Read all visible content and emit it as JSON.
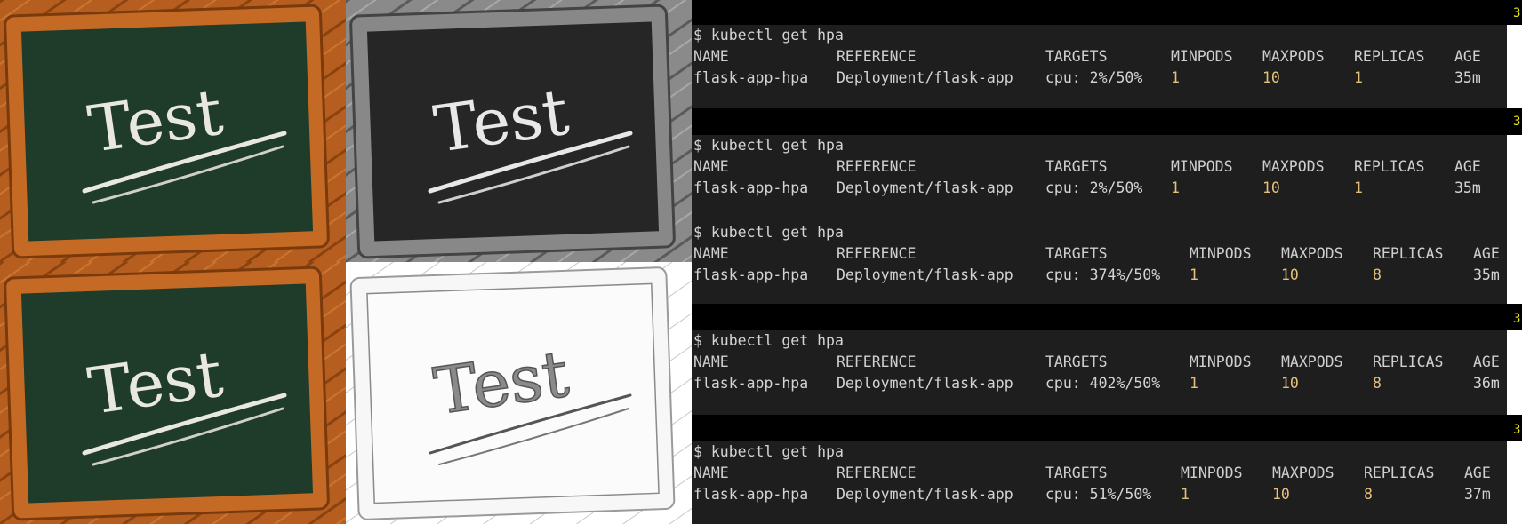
{
  "colors": {
    "wood": "#b35d1e",
    "chalkboard": "#1f3b2a",
    "chalk": "#e8e8e0",
    "terminal_bg": "#1e1e1e",
    "number_text": "#e5c07b",
    "marker_yellow": "#e5e510"
  },
  "images": [
    {
      "name": "chalkboard-test-color",
      "chalk_text": "Test"
    },
    {
      "name": "chalkboard-test-grayscale",
      "chalk_text": "Test"
    },
    {
      "name": "chalkboard-test-color-copy",
      "chalk_text": "Test"
    },
    {
      "name": "chalkboard-test-sketch",
      "chalk_text": "Test"
    }
  ],
  "terminal": {
    "prompt": "$",
    "marker": "3",
    "blocks": [
      {
        "command": "kubectl get hpa",
        "headers": [
          "NAME",
          "REFERENCE",
          "TARGETS",
          "MINPODS",
          "MAXPODS",
          "REPLICAS",
          "AGE"
        ],
        "row": [
          "flask-app-hpa",
          "Deployment/flask-app",
          "cpu: 2%/50%",
          "1",
          "10",
          "1",
          "35m"
        ]
      },
      {
        "command": "kubectl get hpa",
        "headers": [
          "NAME",
          "REFERENCE",
          "TARGETS",
          "MINPODS",
          "MAXPODS",
          "REPLICAS",
          "AGE"
        ],
        "row": [
          "flask-app-hpa",
          "Deployment/flask-app",
          "cpu: 2%/50%",
          "1",
          "10",
          "1",
          "35m"
        ]
      },
      {
        "command": "kubectl get hpa",
        "headers": [
          "NAME",
          "REFERENCE",
          "TARGETS",
          "MINPODS",
          "MAXPODS",
          "REPLICAS",
          "AGE"
        ],
        "row": [
          "flask-app-hpa",
          "Deployment/flask-app",
          "cpu: 374%/50%",
          "1",
          "10",
          "8",
          "35m"
        ]
      },
      {
        "command": "kubectl get hpa",
        "headers": [
          "NAME",
          "REFERENCE",
          "TARGETS",
          "MINPODS",
          "MAXPODS",
          "REPLICAS",
          "AGE"
        ],
        "row": [
          "flask-app-hpa",
          "Deployment/flask-app",
          "cpu: 402%/50%",
          "1",
          "10",
          "8",
          "36m"
        ]
      },
      {
        "command": "kubectl get hpa",
        "headers": [
          "NAME",
          "REFERENCE",
          "TARGETS",
          "MINPODS",
          "MAXPODS",
          "REPLICAS",
          "AGE"
        ],
        "row": [
          "flask-app-hpa",
          "Deployment/flask-app",
          "cpu: 51%/50%",
          "1",
          "10",
          "8",
          "37m"
        ]
      }
    ]
  }
}
